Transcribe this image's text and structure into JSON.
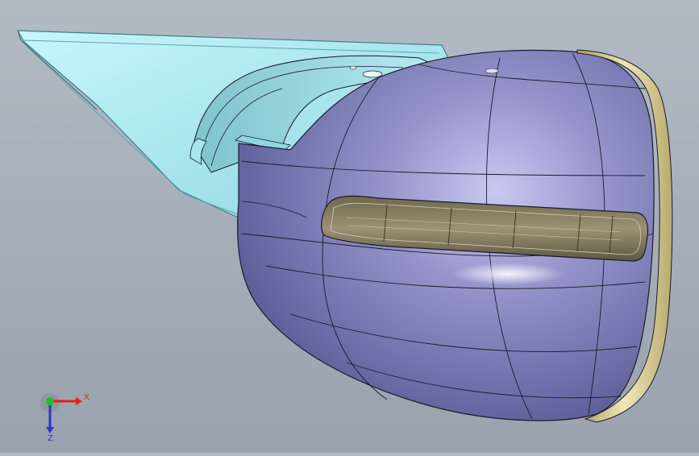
{
  "viewport": {
    "model": "side-mirror-assembly",
    "colors": {
      "background_top": "#b2bbc4",
      "background_bottom": "#9aa3ad",
      "housing": "#6e6fa8",
      "housing_highlight": "#c8c8ee",
      "bracket": "#9fe4ee",
      "bracket_edge": "#5aa6b2",
      "rim": "#d9cf9a",
      "lamp": "#8a8060",
      "edge": "#1a1a2a"
    }
  },
  "triad": {
    "x_label": "X",
    "z_label": "Z",
    "colors": {
      "x": "#e02020",
      "y": "#20c020",
      "z": "#3030d0"
    }
  }
}
